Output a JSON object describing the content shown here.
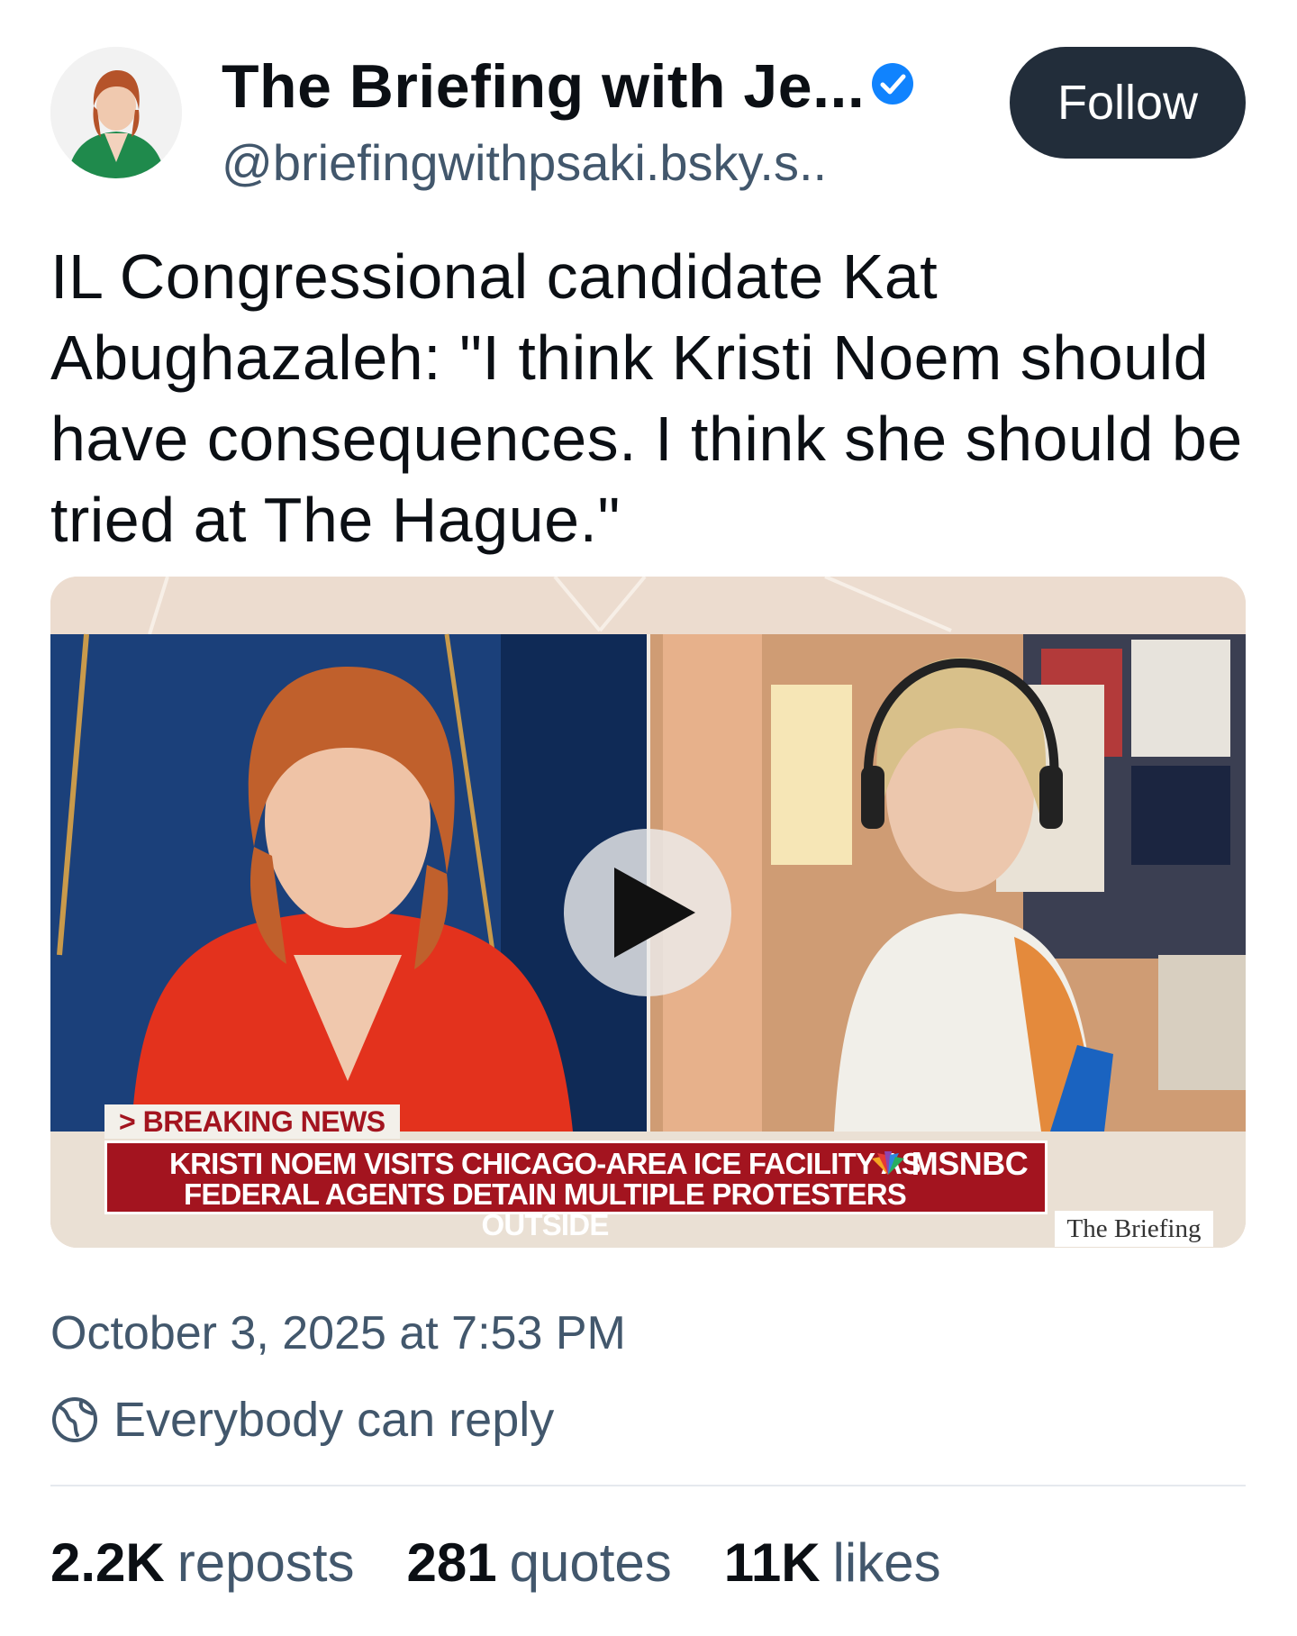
{
  "author": {
    "display_name": "The Briefing with Je...",
    "handle": "@briefingwithpsaki.bsky.s..",
    "verified": true,
    "avatar_icon": "avatar-photo"
  },
  "follow_button": {
    "label": "Follow"
  },
  "post": {
    "text": "IL Congressional candidate Kat Abughazaleh: \"I think Kristi Noem should have consequences. I think she should be tried at The Hague.\""
  },
  "video": {
    "play_icon": "play-icon",
    "breaking_tag": "> BREAKING NEWS",
    "headline": "KRISTI NOEM VISITS CHICAGO-AREA ICE FACILITY AS FEDERAL AGENTS DETAIN MULTIPLE PROTESTERS OUTSIDE",
    "network": "MSNBC",
    "show": "The Briefing"
  },
  "meta": {
    "timestamp": "October 3, 2025 at 7:53 PM",
    "reply_setting": "Everybody can reply",
    "reply_icon": "globe-icon"
  },
  "stats": {
    "reposts": {
      "count": "2.2K",
      "label": "reposts"
    },
    "quotes": {
      "count": "281",
      "label": "quotes"
    },
    "likes": {
      "count": "11K",
      "label": "likes"
    }
  },
  "colors": {
    "follow_bg": "#222d3a",
    "verified": "#1083fe",
    "secondary_text": "#42576c",
    "breaking_red": "#a3141f"
  }
}
